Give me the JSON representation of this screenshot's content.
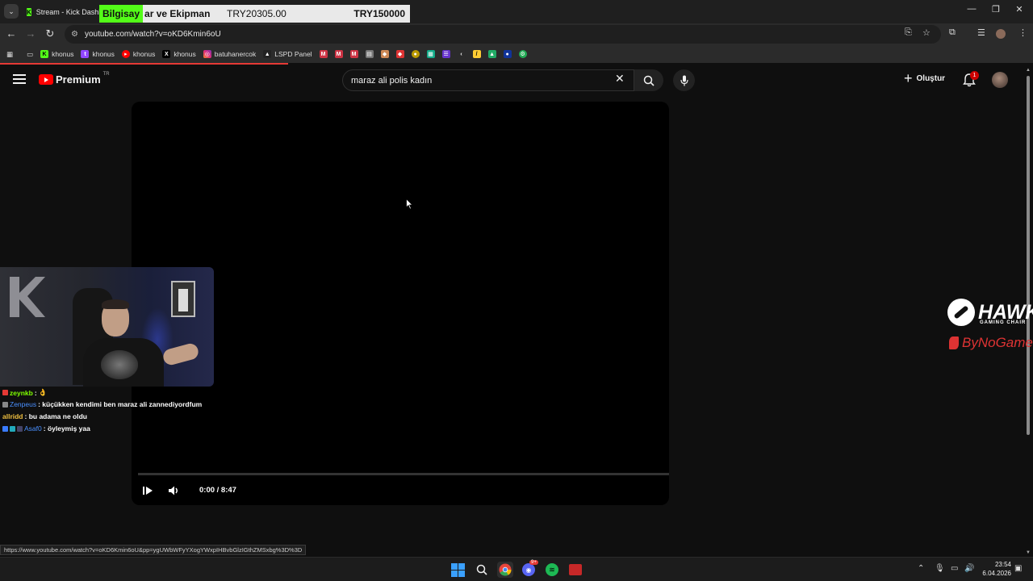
{
  "browser": {
    "tab_title": "Stream - Kick Dashboard",
    "url": "youtube.com/watch?v=oKD6Kmin6oU",
    "bookmarks": [
      {
        "label": "khonus",
        "icon": "kick-icon",
        "color": "#53fc18"
      },
      {
        "label": "khonus",
        "icon": "twitch-icon",
        "color": "#9146ff"
      },
      {
        "label": "khonus",
        "icon": "youtube-icon",
        "color": "#ff0000"
      },
      {
        "label": "khonus",
        "icon": "x-icon",
        "color": "#000000"
      },
      {
        "label": "batuhanercok",
        "icon": "instagram-icon",
        "color": "#e1306c"
      },
      {
        "label": "LSPD Panel",
        "icon": "lspd-icon",
        "color": "#222222"
      }
    ],
    "status_url": "https://www.youtube.com/watch?v=oKD6Kmin6oU&pp=ygUWbWFyYXogYWxpIHBvbGlzIGthZMSxbg%3D%3D"
  },
  "overlay": {
    "category_part1": "Bilgisay",
    "category_part2": "ar ve Ekipman",
    "price_current": "TRY20305.00",
    "price_goal": "TRY150000"
  },
  "youtube": {
    "logo_text": "Premium",
    "country_code": "TR",
    "search_value": "maraz ali polis kadın",
    "create_label": "Oluştur",
    "notification_count": "1",
    "player": {
      "time": "0:00 / 8:47",
      "progress": 0
    }
  },
  "chat": [
    {
      "user": "zeynkb",
      "user_color": "#7fff00",
      "message": " : ",
      "badge_color": "#e53935",
      "emote": "👌"
    },
    {
      "user": "Zenpeus",
      "user_color": "#4a90ff",
      "message": " : küçükken kendimi ben maraz ali zannediyordfum",
      "badge_color": "#888888",
      "emote": ""
    },
    {
      "user": "allridd",
      "user_color": "#f0c040",
      "message": " : bu adama ne oldu",
      "badge_color": "",
      "emote": ""
    },
    {
      "user": "Asaf0",
      "user_color": "#4a90ff",
      "message": " : öyleymiş yaa",
      "badge_color": "#3a7bff",
      "emote": ""
    }
  ],
  "sponsor": {
    "brand": "HAWK",
    "brand_sub": "GAMING CHAIR",
    "partner": "ByNoGame"
  },
  "taskbar": {
    "time": "23:54",
    "date": "6.04.2026",
    "discord_badge": "9+"
  }
}
